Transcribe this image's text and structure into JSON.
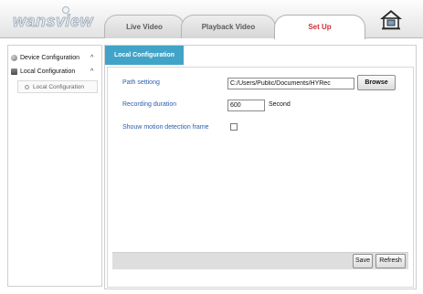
{
  "header": {
    "logo_text": "wansview",
    "tabs": [
      {
        "label": "Live Video",
        "active": false
      },
      {
        "label": "Playback Video",
        "active": false
      },
      {
        "label": "Set Up",
        "active": true
      }
    ],
    "home_icon": "home-icon",
    "active_tab_color": "#d0303a"
  },
  "sidebar": {
    "items": [
      {
        "label": "Device Configuration",
        "icon": "gear-icon",
        "chevron": "^"
      },
      {
        "label": "Local Configuration",
        "icon": "local-config-icon",
        "chevron": "^"
      }
    ],
    "sub_items": [
      {
        "label": "Local  Configuration",
        "icon": "bullet-icon"
      }
    ]
  },
  "main": {
    "tab_label": "Local Configuration",
    "tab_color": "#41a3c7",
    "label_color": "#2a5db0",
    "fields": {
      "path_label": "Path settiong",
      "path_value": "C:/Users/Public/Documents/HYRec",
      "browse_label": "Browse",
      "duration_label": "Recording duration",
      "duration_value": "600",
      "duration_unit": "Second",
      "motion_label": "Shouw motion detection frame",
      "motion_checked": false
    },
    "buttons": {
      "save_label": "Save",
      "refresh_label": "Refresh"
    }
  }
}
